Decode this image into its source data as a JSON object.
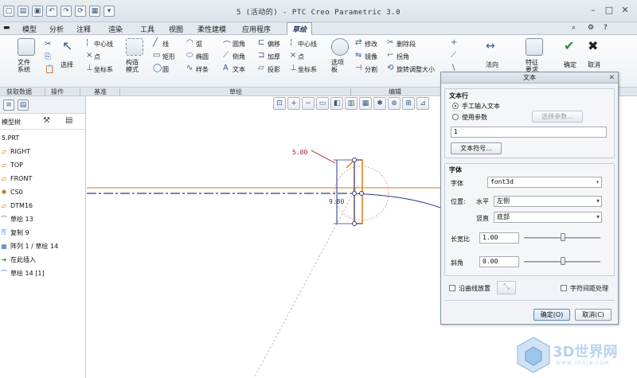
{
  "window": {
    "title": "5 (活动的) - PTC Creo Parametric 3.0"
  },
  "menu": {
    "items": [
      "模型",
      "分析",
      "注释",
      "渲染",
      "工具",
      "视图",
      "柔性建模",
      "应用程序",
      "草绘"
    ]
  },
  "ribbon": {
    "setup": {
      "file_system": "文件\n系统"
    },
    "operations": {
      "select": "选择"
    },
    "datum": {
      "centerline": "中心线",
      "point": "点",
      "coordsys": "坐标系"
    },
    "construction": {
      "label": "构造\n模式"
    },
    "sketch": {
      "line": "线",
      "rectangle": "矩形",
      "circle": "圆",
      "arc": "弧",
      "ellipse": "椭圆",
      "spline": "样条",
      "fillet": "圆角",
      "chamfer": "倒角",
      "text": "文本",
      "offset": "偏移",
      "thicken": "加厚",
      "project": "投影",
      "centerline": "中心线",
      "point": "点",
      "coordsys": "坐标系",
      "palette": "选项\n板"
    },
    "editing": {
      "modify": "修改",
      "mirror": "镜像",
      "divide": "分割",
      "delete_segment": "删除段",
      "corner": "拐角",
      "rotate_resize": "旋转调整大小"
    },
    "constrain": {
      "normal": "法向"
    },
    "inspect": {
      "feature_req": "特征\n要求"
    },
    "ok": "确定",
    "cancel": "取消",
    "groups": [
      "获取数据",
      "操作",
      "基准",
      "草绘",
      "编辑"
    ]
  },
  "model_tree": {
    "title": "模型树",
    "items": [
      "5.PRT",
      "RIGHT",
      "TOP",
      "FRONT",
      "CS0",
      "DTM16",
      "草绘 13",
      "复制 9",
      "阵列 1 / 草绘 14",
      "在此插入",
      "草绘 14 [1]"
    ]
  },
  "canvas": {
    "dim_width": "5.00",
    "dim_height": "9.80"
  },
  "text_dialog": {
    "title": "文本",
    "text_line_section": "文本行",
    "manual_input": "手工输入文本",
    "use_parameter": "使用参数",
    "select_parameter": "选择参数...",
    "text_value": "1",
    "text_symbol": "文本符号...",
    "font_section": "字体",
    "font_label": "字体",
    "font_value": "font3d",
    "position_label": "位置:",
    "horizontal_label": "水平",
    "horizontal_value": "左侧",
    "vertical_label": "竖直",
    "vertical_value": "底部",
    "aspect_label": "长宽比",
    "aspect_value": "1.00",
    "slant_label": "斜角",
    "slant_value": "0.00",
    "place_along_curve": "沿曲线放置",
    "char_spacing": "字符间距处理",
    "ok": "确定(O)",
    "cancel": "取消(C)"
  },
  "watermark": {
    "text": "3D世界网",
    "url": "WWW.3DSJW.COM"
  },
  "colors": {
    "accent": "#3d6fb5",
    "dimension": "#b0102b",
    "sketch_orange": "#e07a18",
    "ok_green": "#2e8b3a",
    "cancel_dark": "#222222"
  }
}
